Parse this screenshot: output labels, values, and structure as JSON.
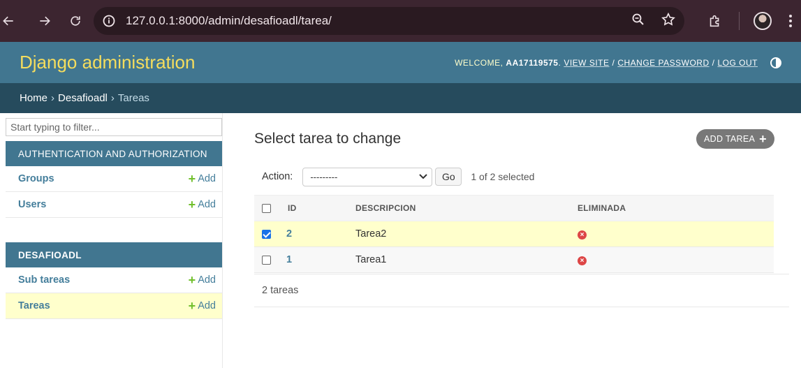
{
  "browser": {
    "url": "127.0.0.1:8000/admin/desafioadl/tarea/",
    "icons": [
      "back-icon",
      "forward-icon",
      "reload-icon",
      "info-icon",
      "zoom-icon",
      "star-icon",
      "extensions-icon",
      "profile-avatar",
      "menu-icon"
    ]
  },
  "header": {
    "brand": "Django administration",
    "welcome": "WELCOME,",
    "username": "AA17119575",
    "view_site": "VIEW SITE",
    "change_password": "CHANGE PASSWORD",
    "log_out": "LOG OUT",
    "slash": "/"
  },
  "breadcrumbs": {
    "home": "Home",
    "app": "Desafioadl",
    "current": "Tareas",
    "separator": "›"
  },
  "sidebar": {
    "filter_placeholder": "Start typing to filter...",
    "add_label": "Add",
    "modules": [
      {
        "caption": "AUTHENTICATION AND AUTHORIZATION",
        "rows": [
          {
            "name": "Groups"
          },
          {
            "name": "Users"
          }
        ]
      },
      {
        "caption": "DESAFIOADL",
        "rows": [
          {
            "name": "Sub tareas"
          },
          {
            "name": "Tareas"
          }
        ]
      }
    ]
  },
  "content": {
    "title": "Select tarea to change",
    "add_button": "ADD TAREA",
    "action_label": "Action:",
    "action_selected": "---------",
    "go_label": "Go",
    "selected_count": "1 of 2 selected",
    "columns": [
      "ID",
      "DESCRIPCION",
      "ELIMINADA"
    ],
    "rows": [
      {
        "id": "2",
        "descripcion": "Tarea2",
        "eliminada": false,
        "checked": true
      },
      {
        "id": "1",
        "descripcion": "Tarea1",
        "eliminada": false,
        "checked": false
      }
    ],
    "result_count": "2 tareas"
  },
  "colors": {
    "header_bg": "#417690",
    "brand": "#f5dd5d",
    "breadcrumbs_bg": "#264b5d",
    "selected_row": "#ffffcc",
    "add_plus": "#70bf2b",
    "false_icon": "#dd4646"
  }
}
